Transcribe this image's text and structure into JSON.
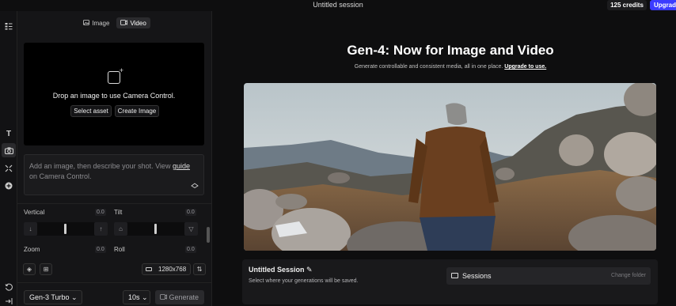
{
  "topbar": {
    "session_title": "Untitled session",
    "credits": "125 credits",
    "upgrade": "Upgrad"
  },
  "rail": {
    "icons": [
      "panel-icon",
      "text-icon",
      "camera-icon",
      "expand-icon",
      "add-icon",
      "history-icon",
      "export-icon"
    ]
  },
  "panel": {
    "tabs": [
      {
        "label": "Image",
        "icon": "image-icon",
        "active": false
      },
      {
        "label": "Video",
        "icon": "video-icon",
        "active": true
      }
    ],
    "dropzone": {
      "text": "Drop an image to use Camera Control.",
      "select_asset": "Select asset",
      "create_image": "Create Image"
    },
    "prompt": {
      "text_before": "Add an image, then describe your shot. View ",
      "link": "guide",
      "text_after": " on Camera Control."
    },
    "controls": {
      "vertical": {
        "label": "Vertical",
        "value": "0.0"
      },
      "tilt": {
        "label": "Tilt",
        "value": "0.0"
      },
      "zoom": {
        "label": "Zoom",
        "value": "0.0"
      },
      "roll": {
        "label": "Roll",
        "value": "0.0"
      }
    },
    "resolution": "1280x768",
    "model": "Gen-3 Turbo",
    "duration": "10s",
    "generate": "Generate"
  },
  "main": {
    "title": "Gen-4: Now for Image and Video",
    "subtitle": "Generate controllable and consistent media, all in one place.",
    "subtitle_link": "Upgrade to use.",
    "session_card": {
      "title": "Untitled Session",
      "subtitle": "Select where your generations will be saved.",
      "sessions_label": "Sessions",
      "change_folder": "Change folder"
    }
  },
  "colors": {
    "accent": "#3b3bff",
    "background": "#0e0e0f",
    "panel": "#151517"
  }
}
